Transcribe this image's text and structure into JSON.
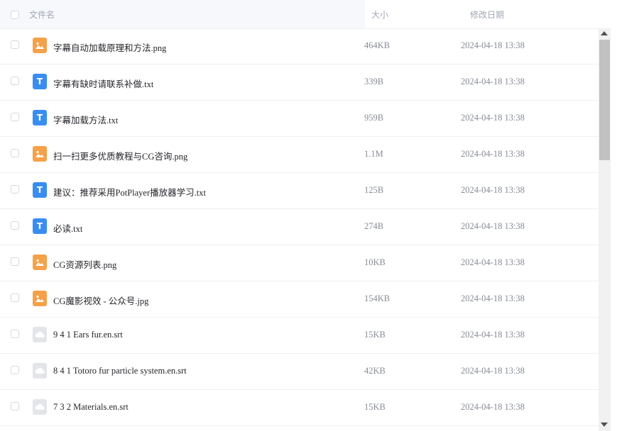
{
  "header": {
    "name_label": "文件名",
    "size_label": "大小",
    "date_label": "修改日期"
  },
  "files": [
    {
      "name": "字幕自动加载原理和方法.png",
      "size": "464KB",
      "date": "2024-04-18 13:38",
      "type": "image",
      "icon": "image-file-icon"
    },
    {
      "name": "字幕有缺时请联系补做.txt",
      "size": "339B",
      "date": "2024-04-18 13:38",
      "type": "text",
      "icon": "text-file-icon"
    },
    {
      "name": "字幕加载方法.txt",
      "size": "959B",
      "date": "2024-04-18 13:38",
      "type": "text",
      "icon": "text-file-icon"
    },
    {
      "name": "扫一扫更多优质教程与CG咨询.png",
      "size": "1.1M",
      "date": "2024-04-18 13:38",
      "type": "image",
      "icon": "image-file-icon"
    },
    {
      "name": "建议：推荐采用PotPlayer播放器学习.txt",
      "size": "125B",
      "date": "2024-04-18 13:38",
      "type": "text",
      "icon": "text-file-icon"
    },
    {
      "name": "必读.txt",
      "size": "274B",
      "date": "2024-04-18 13:38",
      "type": "text",
      "icon": "text-file-icon"
    },
    {
      "name": "CG资源列表.png",
      "size": "10KB",
      "date": "2024-04-18 13:38",
      "type": "image",
      "icon": "image-file-icon"
    },
    {
      "name": "CG魔影视效 - 公众号.jpg",
      "size": "154KB",
      "date": "2024-04-18 13:38",
      "type": "image",
      "icon": "image-file-icon"
    },
    {
      "name": "9 4 1 Ears fur.en.srt",
      "size": "15KB",
      "date": "2024-04-18 13:38",
      "type": "subtitle",
      "icon": "cloud-file-icon"
    },
    {
      "name": "8 4 1 Totoro fur particle system.en.srt",
      "size": "42KB",
      "date": "2024-04-18 13:38",
      "type": "subtitle",
      "icon": "cloud-file-icon"
    },
    {
      "name": "7 3 2 Materials.en.srt",
      "size": "15KB",
      "date": "2024-04-18 13:38",
      "type": "subtitle",
      "icon": "cloud-file-icon"
    }
  ],
  "colors": {
    "image_icon": "#f5a14a",
    "text_icon": "#3a8df0",
    "subtitle_icon": "#e3e5e9",
    "header_bg": "#f6f8fc"
  }
}
